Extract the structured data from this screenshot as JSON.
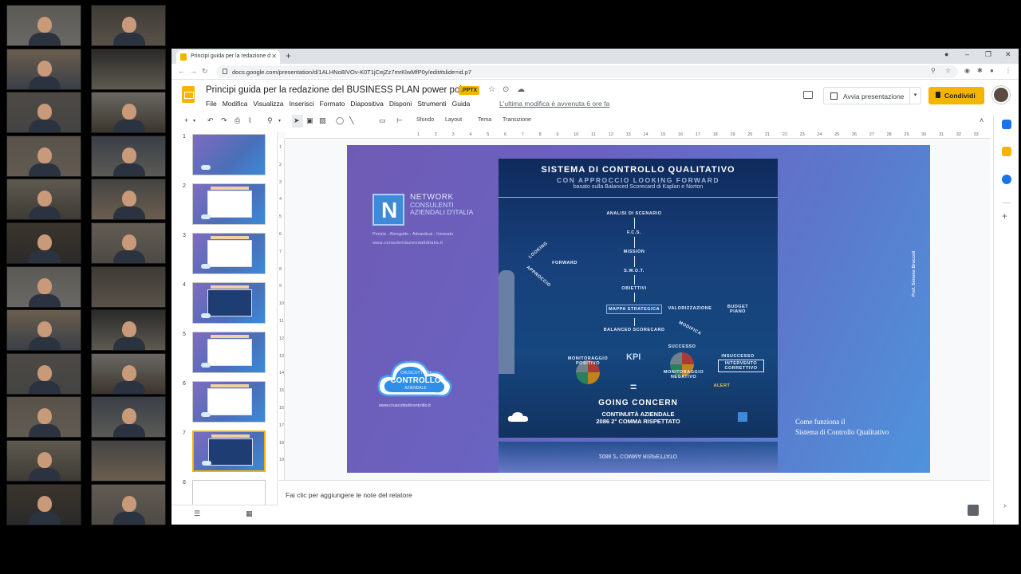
{
  "video_tiles_count": 24,
  "browser": {
    "tab_title": "Principi guida per la redazione d",
    "url": "docs.google.com/presentation/d/1ALHNo8IVOv-K0T1jCejZz7mrKlwMfP0y/edit#slide=id.p7"
  },
  "slides_app": {
    "title": "Principi guida per la redazione del BUSINESS PLAN power point",
    "badge": ".PPTX",
    "menu": [
      "File",
      "Modifica",
      "Visualizza",
      "Inserisci",
      "Formato",
      "Diapositiva",
      "Disponi",
      "Strumenti",
      "Guida"
    ],
    "last_edit": "L'ultima modifica è avvenuta 6 ore fa",
    "present_label": "Avvia presentazione",
    "share_label": "Condividi"
  },
  "toolbar": {
    "background": "Sfondo",
    "layout": "Layout",
    "theme": "Tema",
    "transition": "Transizione"
  },
  "filmstrip": {
    "numbers": [
      "1",
      "2",
      "3",
      "4",
      "5",
      "6",
      "7",
      "8"
    ],
    "active": "7"
  },
  "ruler_h": [
    "1",
    "2",
    "3",
    "4",
    "5",
    "6",
    "7",
    "8",
    "9",
    "10",
    "11",
    "12",
    "13",
    "14",
    "15",
    "16",
    "17",
    "18",
    "19",
    "20",
    "21",
    "22",
    "23",
    "24",
    "25",
    "26",
    "27",
    "28",
    "29",
    "30",
    "31",
    "32",
    "33"
  ],
  "ruler_v": [
    "1",
    "2",
    "3",
    "4",
    "5",
    "6",
    "7",
    "8",
    "9",
    "10",
    "11",
    "12",
    "13",
    "14",
    "15",
    "16",
    "17",
    "18",
    "19"
  ],
  "slide": {
    "network_1": "NETWORK",
    "network_2": "CONSULENTI AZIENDALI D'ITALIA",
    "network_tag": "Perizia · Abregatto · Advanticai · Innovato",
    "network_url": "www.consulentiaziendaliditalia.it",
    "cloud_line1": "CRUSCOTTO DI",
    "cloud_line2": "CONTROLLO",
    "cloud_line3": "AZIENDALE",
    "cloud_url": "www.cruscottodicontrollo.it",
    "poster_title": "SISTEMA DI CONTROLLO QUALITATIVO",
    "poster_sub": "CON APPROCCIO LOOKING FORWARD",
    "poster_sub2": "basato sulla Balanced Scorecard di Kaplan e Norton",
    "flow": [
      "ANALISI DI SCENARIO",
      "F.C.S.",
      "MISSION",
      "S.W.O.T.",
      "OBIETTIVI",
      "MAPPA STRATEGICA",
      "BALANCED SCORECARD"
    ],
    "valorizzazione": "VALORIZZAZIONE",
    "budget": "BUDGET PIANO",
    "modifica": "MODIFICA",
    "forward": "FORWARD",
    "looking": "LOOKING",
    "approccio": "APPROCCIO",
    "kpi": "KPI",
    "mon_pos": "MONITORAGGIO POSITIVO",
    "mon_neg": "MONITORAGGIO NEGATIVO",
    "successo": "SUCCESSO",
    "insuccesso": "INSUCCESSO",
    "intervento": "INTERVENTO CORRETTIVO",
    "alert": "ALERT",
    "going": "GOING CONCERN",
    "cont1": "CONTINUITÀ AZIENDALE",
    "cont2": "2086 2° COMMA RISPETTATO",
    "reflect": "2086 2° COMMA RISPETTATO",
    "vertical": "Prof. Simone Bruccoli",
    "howto1": "Come funziona il",
    "howto2": "Sistema di Controllo Qualitativo"
  },
  "notes_placeholder": "Fai clic per aggiungere le note del relatore"
}
